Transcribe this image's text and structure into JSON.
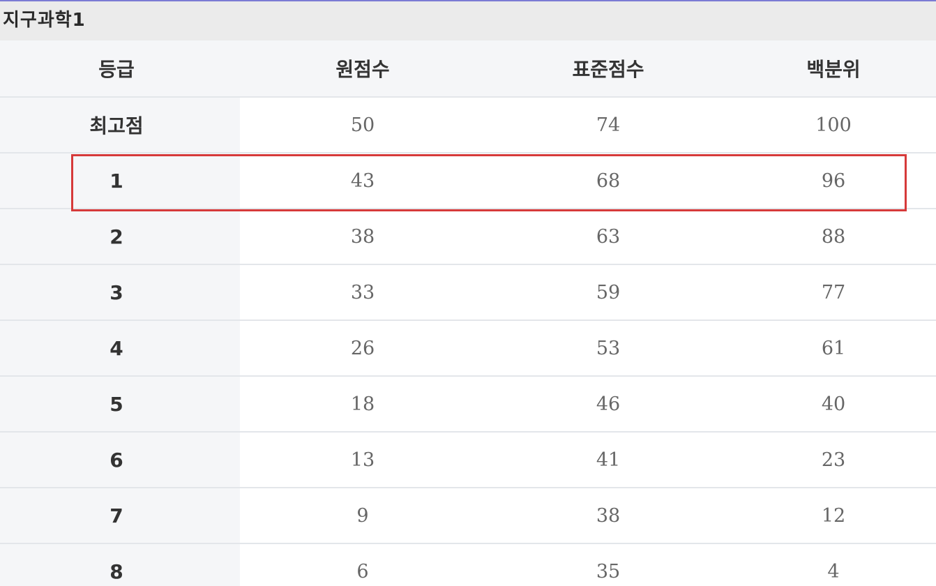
{
  "title": "지구과학1",
  "columns": [
    "등급",
    "원점수",
    "표준점수",
    "백분위"
  ],
  "rows": [
    {
      "grade": "최고점",
      "raw": "50",
      "standard": "74",
      "percentile": "100"
    },
    {
      "grade": "1",
      "raw": "43",
      "standard": "68",
      "percentile": "96"
    },
    {
      "grade": "2",
      "raw": "38",
      "standard": "63",
      "percentile": "88"
    },
    {
      "grade": "3",
      "raw": "33",
      "standard": "59",
      "percentile": "77"
    },
    {
      "grade": "4",
      "raw": "26",
      "standard": "53",
      "percentile": "61"
    },
    {
      "grade": "5",
      "raw": "18",
      "standard": "46",
      "percentile": "40"
    },
    {
      "grade": "6",
      "raw": "13",
      "standard": "41",
      "percentile": "23"
    },
    {
      "grade": "7",
      "raw": "9",
      "standard": "38",
      "percentile": "12"
    },
    {
      "grade": "8",
      "raw": "6",
      "standard": "35",
      "percentile": "4"
    }
  ],
  "highlight": {
    "row_grade": "1",
    "color": "#d63a3a"
  },
  "colors": {
    "header_bg": "#f5f6f8",
    "title_bg": "#ebebeb",
    "border": "#e3e6ea"
  }
}
